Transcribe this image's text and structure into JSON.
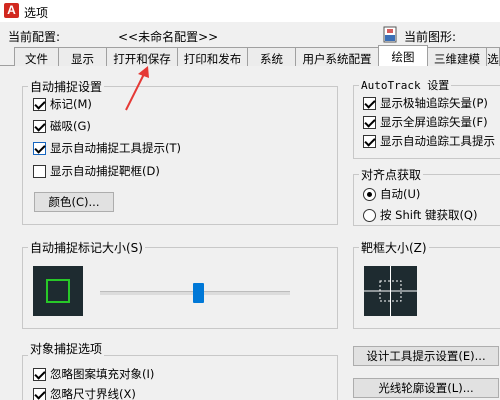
{
  "window": {
    "title": "选项",
    "app_icon_letter": "A"
  },
  "profile": {
    "current_profile_label": "当前配置:",
    "current_profile_value": "<<未命名配置>>",
    "current_drawing_label": "当前图形:"
  },
  "tabs": [
    {
      "label": "文件",
      "active": false
    },
    {
      "label": "显示",
      "active": false
    },
    {
      "label": "打开和保存",
      "active": false
    },
    {
      "label": "打印和发布",
      "active": false
    },
    {
      "label": "系统",
      "active": false
    },
    {
      "label": "用户系统配置",
      "active": false
    },
    {
      "label": "绘图",
      "active": true
    },
    {
      "label": "三维建模",
      "active": false
    },
    {
      "label": "选",
      "active": false
    }
  ],
  "autosnap_settings": {
    "title": "自动捕捉设置",
    "items": [
      {
        "label": "标记(M)",
        "checked": true
      },
      {
        "label": "磁吸(G)",
        "checked": true
      },
      {
        "label": "显示自动捕捉工具提示(T)",
        "checked": true
      },
      {
        "label": "显示自动捕捉靶框(D)",
        "checked": false
      }
    ],
    "colors_button": "颜色(C)..."
  },
  "autotrack_settings": {
    "title": "AutoTrack 设置",
    "items": [
      {
        "label": "显示极轴追踪矢量(P)",
        "checked": true
      },
      {
        "label": "显示全屏追踪矢量(F)",
        "checked": true
      },
      {
        "label": "显示自动追踪工具提示",
        "checked": true
      }
    ]
  },
  "alignment_acquisition": {
    "title": "对齐点获取",
    "options": [
      {
        "label": "自动(U)",
        "selected": true
      },
      {
        "label": "按 Shift 键获取(Q)",
        "selected": false
      }
    ]
  },
  "autosnap_marker_size": {
    "title": "自动捕捉标记大小(S)",
    "slider_value_fraction": 0.52
  },
  "aperture_size": {
    "title": "靶框大小(Z)"
  },
  "object_snap_options": {
    "title": "对象捕捉选项",
    "items": [
      {
        "label": "忽略图案填充对象(I)",
        "checked": true
      },
      {
        "label": "忽略尺寸界线(X)",
        "checked": true
      }
    ]
  },
  "right_buttons": {
    "design_tooltip": "设计工具提示设置(E)...",
    "lightglyph": "光线轮廓设置(L)..."
  },
  "colors": {
    "accent": "#0078d7",
    "preview_bg": "#1e2b30",
    "marker_green": "#28c828",
    "annotation_red": "#e53935"
  }
}
